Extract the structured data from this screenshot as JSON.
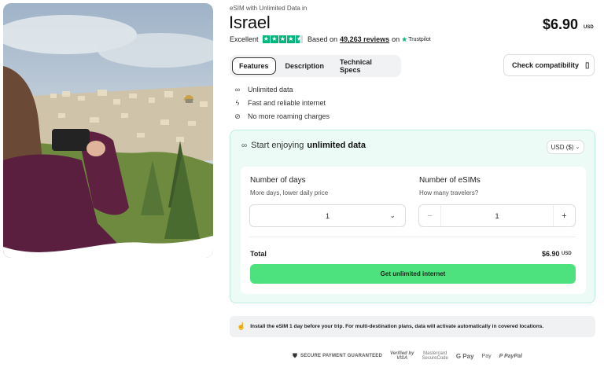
{
  "header": {
    "eyebrow": "eSIM with Unlimited Data in",
    "title": "Israel",
    "price": "$6.90",
    "price_currency": "USD"
  },
  "rating": {
    "label": "Excellent",
    "stars": 4.5,
    "based_on": "Based on",
    "reviews": "49,263 reviews",
    "on": "on",
    "provider": "Trustpilot"
  },
  "tabs": [
    {
      "label": "Features",
      "active": true
    },
    {
      "label": "Description",
      "active": false
    },
    {
      "label": "Technical Specs",
      "active": false
    }
  ],
  "compatibility_button": "Check compatibility",
  "features": [
    {
      "icon": "infinity-icon",
      "label": "Unlimited data"
    },
    {
      "icon": "lightning-icon",
      "label": "Fast and reliable internet"
    },
    {
      "icon": "no-roaming-icon",
      "label": "No more roaming charges"
    }
  ],
  "plan": {
    "heading_prefix": "Start enjoying",
    "heading_bold": "unlimited data",
    "currency_select": "USD ($)",
    "days": {
      "title": "Number of days",
      "subtitle": "More days, lower daily price",
      "value": "1"
    },
    "esims": {
      "title": "Number of eSIMs",
      "subtitle": "How many travelers?",
      "value": "1",
      "minus": "−",
      "plus": "+"
    },
    "total_label": "Total",
    "total_value": "$6.90",
    "total_currency": "USD",
    "cta": "Get unlimited internet"
  },
  "info": "Install the eSIM 1 day before your trip. For multi-destination plans, data will activate automatically in covered locations.",
  "footer": {
    "secure": "SECURE PAYMENT GUARANTEED",
    "visa_top": "Verified by",
    "visa_bottom": "VISA",
    "mc_top": "Mastercard",
    "mc_bottom": "SecureCode",
    "gpay": "G Pay",
    "apay": " Pay",
    "paypal": "PayPal"
  },
  "colors": {
    "accent_green": "#4ee27e",
    "trustpilot_green": "#00b67a",
    "card_bg": "#ecfbf6"
  }
}
